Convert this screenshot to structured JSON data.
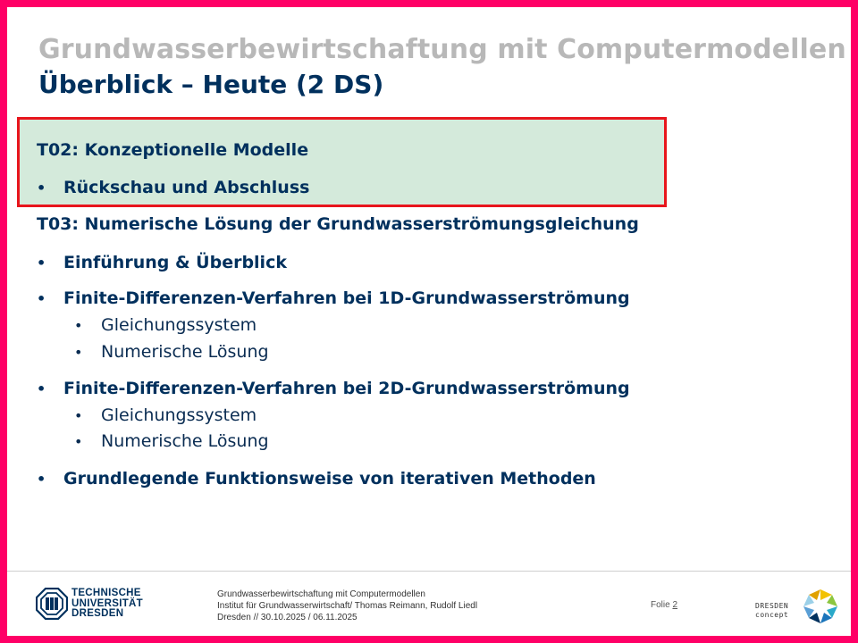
{
  "header": {
    "course_title": "Grundwasserbewirtschaftung mit Computermodellen",
    "slide_title": "Überblick – Heute (2 DS)"
  },
  "agenda": {
    "t02": {
      "heading": "T02: Konzeptionelle  Modelle",
      "items": [
        "Rückschau und Abschluss"
      ]
    },
    "t03": {
      "heading": "T03: Numerische Lösung der Grundwasserströmungsgleichung",
      "items": [
        {
          "label": "Einführung & Überblick",
          "sub": []
        },
        {
          "label": "Finite-Differenzen-Verfahren  bei  1D-Grundwasserströmung",
          "sub": [
            "Gleichungssystem",
            "Numerische Lösung"
          ]
        },
        {
          "label": "Finite-Differenzen-Verfahren  bei  2D-Grundwasserströmung",
          "sub": [
            "Gleichungssystem",
            "Numerische Lösung"
          ]
        },
        {
          "label": "Grundlegende  Funktionsweise  von iterativen  Methoden",
          "sub": []
        }
      ]
    },
    "bullet": "•"
  },
  "footer": {
    "university": [
      "TECHNISCHE",
      "UNIVERSITÄT",
      "DRESDEN"
    ],
    "info_lines": [
      "Grundwasserbewirtschaftung mit Computermodellen",
      "Institut für Grundwasserwirtschaft/ Thomas Reimann, Rudolf Liedl",
      "Dresden // 30.10.2025  / 06.11.2025"
    ],
    "slide_label": "Folie",
    "slide_number": "2",
    "partner": [
      "DRESDEN",
      "concept"
    ]
  },
  "colors": {
    "frame": "#ff0066",
    "title_gray": "#b8b8b8",
    "navy": "#00305d",
    "highlight_fill": "#d4eadb",
    "highlight_border": "#e8151c"
  },
  "icons": {
    "university_logo": "tu-dresden-logo-icon",
    "partner_logo": "dresden-concept-logo-icon"
  }
}
